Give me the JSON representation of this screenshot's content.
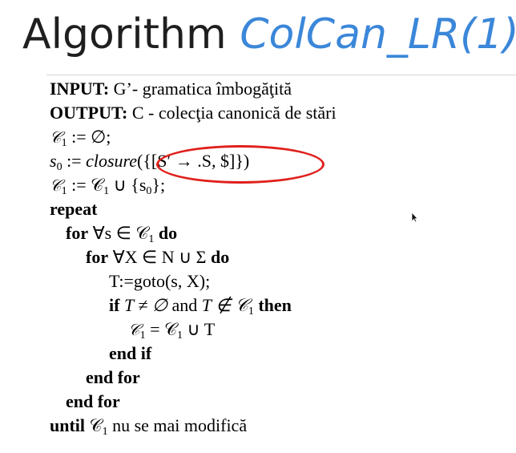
{
  "header": {
    "title_main": "Algorithm ",
    "title_name": "ColCan_LR(1)"
  },
  "algorithm": {
    "input_kw": "INPUT:",
    "input_text": " G’- gramatica îmbogăţită",
    "output_kw": "OUTPUT:",
    "output_text": " C - colecţia canonică de stări",
    "line_init": ":= ∅;",
    "line_s0_a": ":= ",
    "line_s0_closure": "closure",
    "line_s0_b": "({[S′ → .S, $]})",
    "line_union": ":= 𝒞",
    "line_union_b": " ∪ {s",
    "line_union_c": "};",
    "repeat_kw": "repeat",
    "for1_kw": "for",
    "for1_text": " ∀s ∈ 𝒞",
    "do_kw": "do",
    "for2_kw": "for",
    "for2_text": " ∀X ∈ N ∪ Σ ",
    "goto_text": "T:=goto(s, X);",
    "if_kw": "if",
    "if_cond_a": " T ≠ ∅ ",
    "and_text": "and",
    "if_cond_b": " T ∉ 𝒞",
    "then_kw": "then",
    "assign_text": "𝒞",
    "assign_rest": " = 𝒞",
    "assign_tail": " ∪ T",
    "end_if": "end if",
    "end_for": "end for",
    "until_kw": "until",
    "until_text": " 𝒞",
    "until_tail": " nu se mai modifică",
    "sub_1": "1",
    "sub_0": "0",
    "c_symbol": "𝒞",
    "s_symbol": "s"
  },
  "colors": {
    "accent": "#3b87d9",
    "highlight_ring": "#e0201c"
  }
}
